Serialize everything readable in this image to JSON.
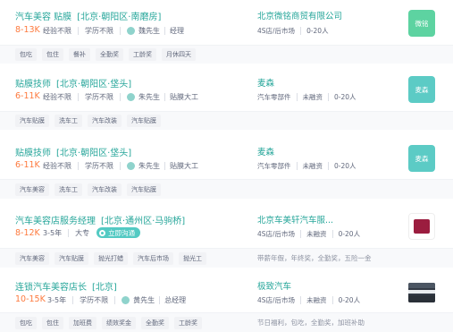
{
  "colors": {
    "accent": "#26a69a",
    "salary": "#fd7a3e",
    "logo_green": "#5dd3a1",
    "logo_teal": "#5ccbc5",
    "tag_bg": "#f1f2f5"
  },
  "jobs": [
    {
      "title": "汽车美容 贴膜",
      "location": "[北京·朝阳区·南磨房]",
      "salary": "8-13K",
      "experience": "经验不限",
      "education": "学历不限",
      "recruiter_name": "魏先生",
      "recruiter_role": "经理",
      "company": "北京微铭商贸有限公司",
      "industry": "4S店/后市场",
      "size": "0-20人",
      "logo_text": "微铭",
      "tags": [
        "包吃",
        "包住",
        "餐补",
        "全勤奖",
        "工龄奖",
        "月休四天"
      ]
    },
    {
      "title": "贴膜技师",
      "location": "[北京·朝阳区·垡头]",
      "salary": "6-11K",
      "experience": "经验不限",
      "education": "学历不限",
      "recruiter_name": "朱先生",
      "recruiter_role": "贴膜大工",
      "company": "麦森",
      "industry": "汽车零部件",
      "funding": "未融资",
      "size": "0-20人",
      "logo_text": "麦森",
      "tags": [
        "汽车贴膜",
        "洗车工",
        "汽车改装",
        "汽车贴膜"
      ]
    },
    {
      "title": "贴膜技师",
      "location": "[北京·朝阳区·垡头]",
      "salary": "6-11K",
      "experience": "经验不限",
      "education": "学历不限",
      "recruiter_name": "朱先生",
      "recruiter_role": "贴膜大工",
      "company": "麦森",
      "industry": "汽车零部件",
      "funding": "未融资",
      "size": "0-20人",
      "logo_text": "麦森",
      "tags": [
        "汽车美容",
        "洗车工",
        "汽车改装",
        "汽车贴膜"
      ]
    },
    {
      "title": "汽车美容店服务经理",
      "location": "[北京·通州区·马驹桥]",
      "salary": "8-12K",
      "experience": "3-5年",
      "education": "大专",
      "chat_label": "立即沟通",
      "company": "北京车美轩汽车服...",
      "industry": "4S店/后市场",
      "funding": "未融资",
      "size": "0-20人",
      "tags": [
        "汽车美容",
        "汽车贴膜",
        "抛光打蜡",
        "汽车后市场",
        "抛光工"
      ],
      "welfare": "带薪年假，年终奖，全勤奖，五险一金"
    },
    {
      "title": "连锁汽车美容店长",
      "location": "[北京]",
      "salary": "10-15K",
      "experience": "3-5年",
      "education": "学历不限",
      "recruiter_name": "黄先生",
      "recruiter_role": "总经理",
      "company": "极致汽车",
      "industry": "4S店/后市场",
      "funding": "未融资",
      "size": "0-20人",
      "tags": [
        "包吃",
        "包住",
        "加班费",
        "绩效奖金",
        "全勤奖",
        "工龄奖"
      ],
      "welfare": "节日福利，包吃，全勤奖，加班补助"
    }
  ]
}
